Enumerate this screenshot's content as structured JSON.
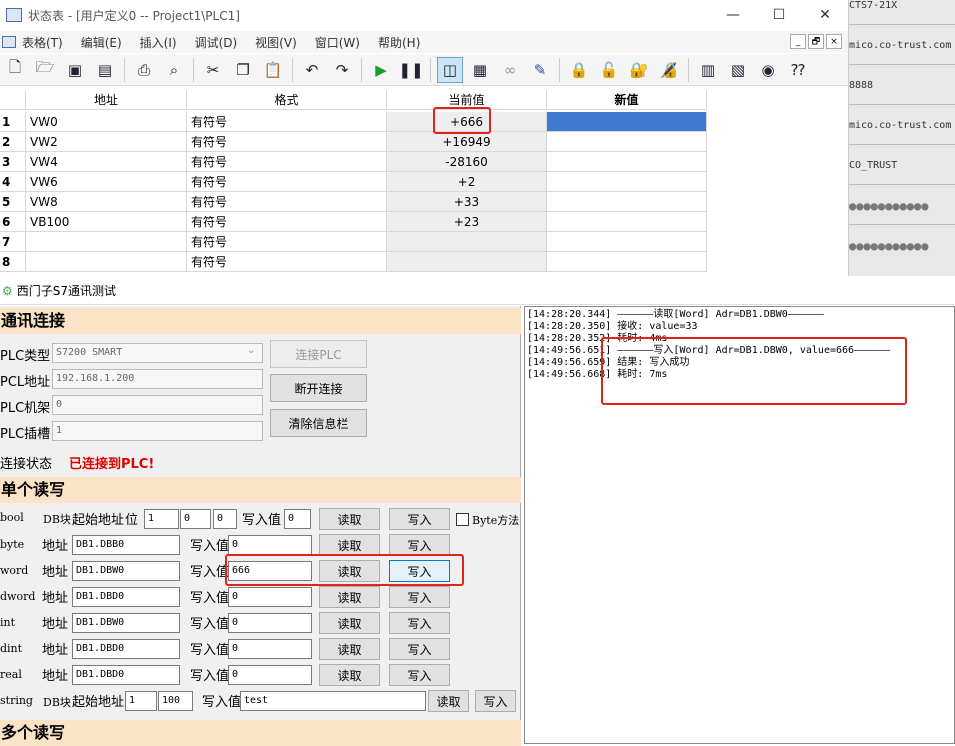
{
  "top_window": {
    "title": "状态表 - [用户定义0 -- Project1\\PLC1]",
    "controls": {
      "minimize": "—",
      "maximize": "☐",
      "close": "✕"
    },
    "menu": [
      "表格(T)",
      "编辑(E)",
      "插入(I)",
      "调试(D)",
      "视图(V)",
      "窗口(W)",
      "帮助(H)"
    ],
    "mdi_controls": [
      "_",
      "🗗",
      "×"
    ],
    "toolbar_icons": [
      "new-file-icon",
      "open-folder-icon",
      "save-icon",
      "save-all-icon",
      "print-icon",
      "print-preview-icon",
      "cut-icon",
      "copy-icon",
      "paste-icon",
      "undo-icon",
      "redo-icon",
      "run-icon",
      "stop-icon",
      "chart-status-icon",
      "table-status-icon",
      "glasses-icon",
      "pen-icon",
      "lock-icon",
      "unlock-icon",
      "force-lock-icon",
      "unforce-icon",
      "read-icon",
      "write-icon",
      "trend-icon",
      "help-icon"
    ]
  },
  "status_table": {
    "headers": [
      "地址",
      "格式",
      "当前值",
      "新值"
    ],
    "rows": [
      {
        "n": "1",
        "addr": "VW0",
        "fmt": "有符号",
        "cur": "+666",
        "new": ""
      },
      {
        "n": "2",
        "addr": "VW2",
        "fmt": "有符号",
        "cur": "+16949",
        "new": ""
      },
      {
        "n": "3",
        "addr": "VW4",
        "fmt": "有符号",
        "cur": "-28160",
        "new": ""
      },
      {
        "n": "4",
        "addr": "VW6",
        "fmt": "有符号",
        "cur": "+2",
        "new": ""
      },
      {
        "n": "5",
        "addr": "VW8",
        "fmt": "有符号",
        "cur": "+33",
        "new": ""
      },
      {
        "n": "6",
        "addr": "VB100",
        "fmt": "有符号",
        "cur": "+23",
        "new": ""
      },
      {
        "n": "7",
        "addr": "",
        "fmt": "有符号",
        "cur": "",
        "new": ""
      },
      {
        "n": "8",
        "addr": "",
        "fmt": "有符号",
        "cur": "",
        "new": ""
      }
    ]
  },
  "right_strip": [
    "CTS7-21X",
    "mico.co-trust.com",
    "8888",
    "mico.co-trust.com",
    "CO_TRUST",
    "●●●●●●●●●●●",
    "●●●●●●●●●●●"
  ],
  "bottom_window": {
    "title": "西门子S7通讯测试",
    "sections": {
      "connect": "通讯连接",
      "single": "单个读写",
      "multi": "多个读写"
    },
    "plc_type_label": "PLC类型",
    "plc_type_value": "S7200 SMART",
    "plc_addr_label": "PCL地址",
    "plc_addr_value": "192.168.1.200",
    "rack_label": "PLC机架",
    "rack_value": "0",
    "slot_label": "PLC插槽",
    "slot_value": "1",
    "btn_connect": "连接PLC",
    "btn_disconnect": "断开连接",
    "btn_clear": "清除信息栏",
    "conn_state_label": "连接状态",
    "conn_state_value": "已连接到PLC!",
    "bool_row": {
      "type": "bool",
      "db": "DB块",
      "start": "起始地址",
      "bit": "位",
      "v1": "1",
      "v2": "0",
      "v3": "0",
      "wlabel": "写入值",
      "wval": "0",
      "read": "读取",
      "write": "写入",
      "chk": "Byte方法"
    },
    "rows": [
      {
        "type": "byte",
        "addr_label": "地址",
        "addr": "DB1.DBB0",
        "wlabel": "写入值",
        "wval": "0",
        "read": "读取",
        "write": "写入"
      },
      {
        "type": "word",
        "addr_label": "地址",
        "addr": "DB1.DBW0",
        "wlabel": "写入值",
        "wval": "666",
        "read": "读取",
        "write": "写入"
      },
      {
        "type": "dword",
        "addr_label": "地址",
        "addr": "DB1.DBD0",
        "wlabel": "写入值",
        "wval": "0",
        "read": "读取",
        "write": "写入"
      },
      {
        "type": "int",
        "addr_label": "地址",
        "addr": "DB1.DBW0",
        "wlabel": "写入值",
        "wval": "0",
        "read": "读取",
        "write": "写入"
      },
      {
        "type": "dint",
        "addr_label": "地址",
        "addr": "DB1.DBD0",
        "wlabel": "写入值",
        "wval": "0",
        "read": "读取",
        "write": "写入"
      },
      {
        "type": "real",
        "addr_label": "地址",
        "addr": "DB1.DBD0",
        "wlabel": "写入值",
        "wval": "0",
        "read": "读取",
        "write": "写入"
      }
    ],
    "string_row": {
      "type": "string",
      "db": "DB块",
      "start": "起始地址",
      "v1": "1",
      "v2": "100",
      "wlabel": "写入值",
      "wval": "test",
      "read": "读取",
      "write": "写入"
    },
    "log": [
      "[14:28:20.344] ——————读取[Word] Adr=DB1.DBW0——————",
      "[14:28:20.350] 接收: value=33",
      "[14:28:20.352] 耗时: 4ms",
      "[14:49:56.651] ——————写入[Word] Adr=DB1.DBW0, value=666——————",
      "[14:49:56.659] 结果: 写入成功",
      "[14:49:56.668] 耗时: 7ms"
    ]
  },
  "colors": {
    "highlight": "#e0241a",
    "section_bg": "#fbe3c8",
    "selected_cell": "#3e7bd0",
    "status_text": "#e00000"
  }
}
